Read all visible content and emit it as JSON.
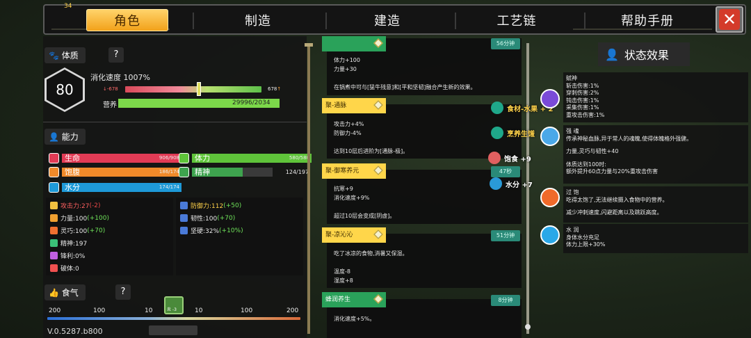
{
  "tabs": {
    "counter": "34",
    "items": [
      {
        "label": "角色",
        "active": true
      },
      {
        "label": "制造",
        "active": false
      },
      {
        "label": "建造",
        "active": false
      },
      {
        "label": "工艺链",
        "active": false
      },
      {
        "label": "帮助手册",
        "active": false
      }
    ],
    "close_icon": "close-icon"
  },
  "left": {
    "constitution": {
      "title": "体质",
      "help": "?",
      "level": "80",
      "digest_speed": "消化速度 1007%",
      "range_min": "-678",
      "range_max": "678",
      "nutrition_label": "营养",
      "nutrition_value": "29996/2034",
      "nutrition_fraction": 1.0
    },
    "ability": {
      "title": "能力",
      "bars": [
        {
          "label": "生命",
          "value": "906/908",
          "fraction": 1.0,
          "color": "#e23b55",
          "icon": "heart-icon"
        },
        {
          "label": "体力",
          "value": "580/580",
          "fraction": 1.0,
          "color": "#5fc43a",
          "icon": "lightning-icon"
        },
        {
          "label": "饱腹",
          "value": "186/174",
          "fraction": 1.0,
          "color": "#f08a2a",
          "icon": "meat-icon"
        },
        {
          "label": "精神",
          "value": "124/197",
          "fraction": 0.63,
          "color": "#3ea34e",
          "icon": "brain-icon"
        },
        {
          "label": "水分",
          "value": "174/174",
          "fraction": 1.0,
          "color": "#1e9ad8",
          "icon": "water-icon"
        }
      ],
      "left_stats": [
        {
          "label": "攻击力:27",
          "extra": "(-2)",
          "extra_color": "#e84848",
          "icon": "attack-icon"
        },
        {
          "label": "力量:100",
          "extra": "(+100)",
          "extra_color": "#6fe35a",
          "icon": "strength-icon"
        },
        {
          "label": "灵巧:100",
          "extra": "(+70)",
          "extra_color": "#6fe35a",
          "icon": "agility-icon"
        },
        {
          "label": "精神:197",
          "extra": "",
          "extra_color": "",
          "icon": "spirit-icon"
        },
        {
          "label": "锋利:0%",
          "extra": "",
          "extra_color": "",
          "icon": "sharp-icon"
        },
        {
          "label": "破体:0",
          "extra": "",
          "extra_color": "",
          "icon": "pierce-icon"
        }
      ],
      "right_stats": [
        {
          "label": "防御力:112",
          "extra": "(+50)",
          "extra_color": "#6fe35a",
          "icon": "defense-icon"
        },
        {
          "label": "韧性:100",
          "extra": "(+70)",
          "extra_color": "#6fe35a",
          "icon": "toughness-icon"
        },
        {
          "label": "坚硬:32%",
          "extra": "(+10%)",
          "extra_color": "#6fe35a",
          "icon": "hardness-icon"
        }
      ]
    },
    "appetite": {
      "title": "食气",
      "help": "?",
      "scale": [
        "200",
        "100",
        "10",
        "10",
        "100",
        "200"
      ],
      "marker_label": "炎 -3",
      "version": "V.0.5287.b800"
    }
  },
  "middle": {
    "top_card_time": "56分钟",
    "top_card_lines": [
      "体力+100",
      "力量+30",
      "",
      "在锅煮中可与[猛牛残意]和[平和坚韧]融合产生新的效果。"
    ],
    "cards": [
      {
        "title": "聚-通脉",
        "lines": [
          "攻击力+4%",
          "防御力-4%",
          "",
          "达到10层后进阶为[通脉-极]。"
        ],
        "time": ""
      },
      {
        "title": "聚-御寒养元",
        "lines": [
          "抗寒+9",
          "消化速度+9%",
          "",
          "超过10层会变成[阴虚]。"
        ],
        "time": "47秒"
      },
      {
        "title": "聚-凉沁沁",
        "lines": [
          "吃了冰凉的食物,消暑又保湿。",
          "",
          "温度-8",
          "湿度+8"
        ],
        "time": "51分钟"
      },
      {
        "title": "蜂润养生",
        "lines": [
          "消化速度+5%。"
        ],
        "time": "8分钟"
      }
    ],
    "floating": [
      {
        "label": "食材-水果 + 2",
        "color": "#ffd24a",
        "icon": "fruit-tag-icon"
      },
      {
        "label": "烹养生馐",
        "color": "#ffd24a",
        "icon": "cook-tag-icon"
      },
      {
        "label": "饱食 +9",
        "color": "#ffffff",
        "icon": "meat-icon"
      },
      {
        "label": "水分 +7",
        "color": "#ffffff",
        "icon": "water-drop-icon"
      }
    ]
  },
  "right": {
    "title": "状态效果",
    "effects": [
      {
        "lines": [
          "赋神",
          "斩击伤害:1%",
          "穿刺伤害:2%",
          "钝击伤害:1%",
          "采集伤害:1%",
          "重攻击伤害:1%"
        ],
        "icon": "spirit-orb-icon"
      },
      {
        "lines": [
          "强 魂",
          "传承神秘血脉,异于常人的魂魄,使得体魄格外强健。",
          "",
          "力量,灵巧与韧性+40",
          "",
          "体质达到100时:",
          "额外提升60点力量与20%重攻击伤害"
        ],
        "icon": "soul-orb-icon"
      },
      {
        "lines": [
          "过 饱",
          "吃得太饱了,无法继续摄入食物中的营养。",
          "",
          "减少冲刺速度,闪避距离以及跳跃高度。"
        ],
        "icon": "full-belly-icon"
      },
      {
        "lines": [
          "水 润",
          "身体水分充足",
          "体力上限+30%"
        ],
        "icon": "water-drop-icon"
      }
    ]
  }
}
